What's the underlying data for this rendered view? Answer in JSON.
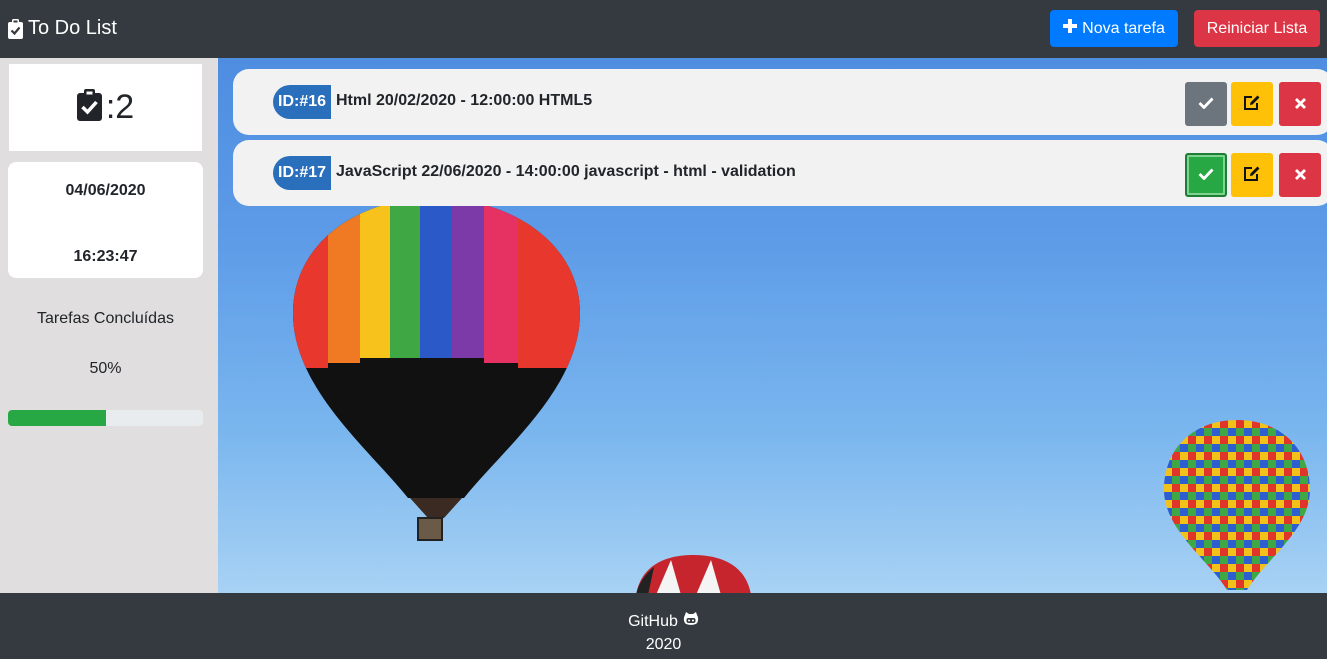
{
  "navbar": {
    "brand_icon": "clipboard-check-icon",
    "brand_title": "To Do List",
    "new_task_label": "Nova tarefa",
    "new_task_icon": "plus-icon",
    "reset_label": "Reiniciar Lista",
    "colors": {
      "new": "#007bff",
      "reset": "#dc3545"
    }
  },
  "sidebar": {
    "task_count_icon": "clipboard-check-icon",
    "task_count": ":2",
    "date": "04/06/2020",
    "time": "16:23:47",
    "completed_label": "Tarefas Concluídas",
    "completed_percent_text": "50%",
    "completed_progress": 0.5
  },
  "tasks": [
    {
      "id_badge": "ID:#16",
      "text": "Html 20/02/2020 - 12:00:00 HTML5",
      "done": false
    },
    {
      "id_badge": "ID:#17",
      "text": "JavaScript 22/06/2020 - 14:00:00 javascript - html - validation",
      "done": true
    }
  ],
  "task_actions": {
    "complete_icon": "check-icon",
    "edit_icon": "edit-icon",
    "delete_icon": "close-icon"
  },
  "footer": {
    "github_label": "GitHub",
    "github_icon": "github-icon",
    "year": "2020"
  }
}
